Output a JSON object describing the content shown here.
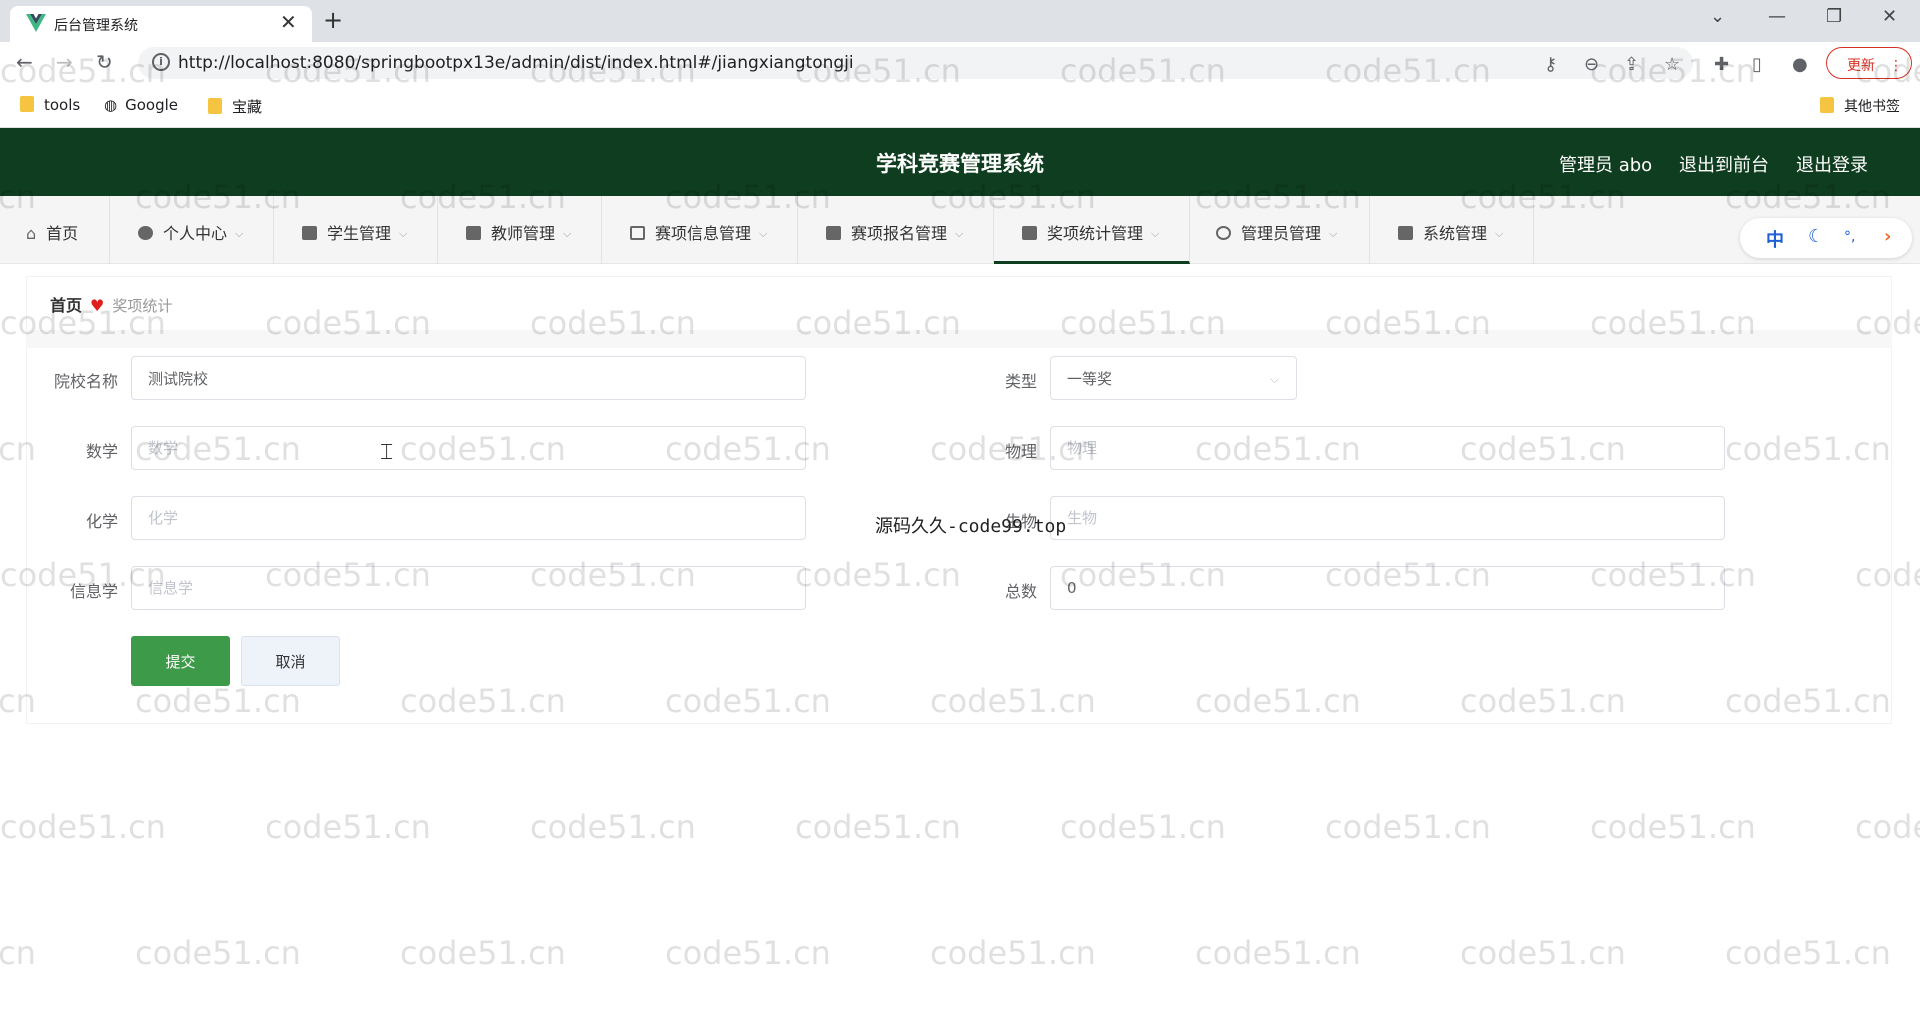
{
  "browser": {
    "tab_title": "后台管理系统",
    "close_glyph": "✕",
    "new_tab_glyph": "+",
    "url": "http://localhost:8080/springbootpx13e/admin/dist/index.html#/jiangxiangtongji",
    "update_label": "更新",
    "bookmarks": [
      "tools",
      "Google",
      "宝藏"
    ],
    "other_bookmarks": "其他书签"
  },
  "header": {
    "title": "学科竞赛管理系统",
    "user": "管理员 abo",
    "back_to_front": "退出到前台",
    "logout": "退出登录"
  },
  "menu": {
    "items": [
      {
        "label": "首页"
      },
      {
        "label": "个人中心"
      },
      {
        "label": "学生管理"
      },
      {
        "label": "教师管理"
      },
      {
        "label": "赛项信息管理"
      },
      {
        "label": "赛项报名管理"
      },
      {
        "label": "奖项统计管理"
      },
      {
        "label": "管理员管理"
      },
      {
        "label": "系统管理"
      }
    ],
    "lang_zh": "中"
  },
  "breadcrumb": {
    "home": "首页",
    "current": "奖项统计"
  },
  "form": {
    "school": {
      "label": "院校名称",
      "value": "测试院校"
    },
    "type": {
      "label": "类型",
      "value": "一等奖"
    },
    "math": {
      "label": "数学",
      "placeholder": "数学"
    },
    "physics": {
      "label": "物理",
      "placeholder": "物理"
    },
    "chemistry": {
      "label": "化学",
      "placeholder": "化学"
    },
    "biology": {
      "label": "生物",
      "placeholder": "生物"
    },
    "informatics": {
      "label": "信息学",
      "placeholder": "信息学"
    },
    "total": {
      "label": "总数",
      "value": "0"
    },
    "submit": "提交",
    "cancel": "取消"
  },
  "overlay_text": "源码久久-code99.top",
  "watermark": "code51.cn"
}
